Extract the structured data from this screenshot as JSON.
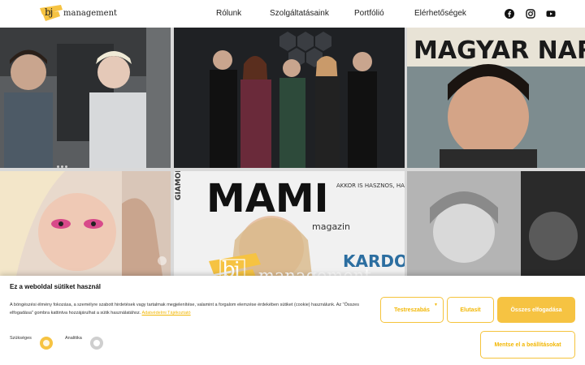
{
  "header": {
    "logo_mono": "bj",
    "logo_word": "management",
    "nav": [
      "Rólunk",
      "Szolgáltatásaink",
      "Portfólió",
      "Elérhetőségek"
    ],
    "social_icons": [
      "facebook-icon",
      "instagram-icon",
      "youtube-icon"
    ]
  },
  "hero": {
    "magazine_top_text": "MAGYAR NARANCS",
    "magazine_title": "MAMI",
    "magazine_side_text": "AKKOR IS HASZNOS, HA MÉG NEM VAGY ANYA",
    "magazine_corner": "GIAMOLI",
    "magazine_name": "KARDOS",
    "magazine_sub": "magazin",
    "overlay_logo_mono": "bj",
    "overlay_logo_word": "management"
  },
  "cookie": {
    "title": "Ez a weboldal sütiket használ",
    "text": "A böngészési élmény fokozása, a személyre szabott hirdetések vagy tartalmak megjelenítése, valamint a forgalom elemzése érdekében sütiket (cookie) használunk. Az \"Összes elfogadása\" gombra kattintva hozzájárulhat a sütik használatához.",
    "link_text": "Adatvédelmi Tájékoztató",
    "toggles": [
      {
        "label": "Szükséges",
        "on": true
      },
      {
        "label": "Analitika",
        "on": false
      }
    ],
    "buttons": {
      "customize": "Testreszabás",
      "reject": "Elutasít",
      "accept_all": "Összes elfogadása",
      "save": "Mentse el a beállításokat"
    }
  },
  "colors": {
    "accent": "#f6c342",
    "accent_text": "#f2b705",
    "text": "#222222"
  }
}
